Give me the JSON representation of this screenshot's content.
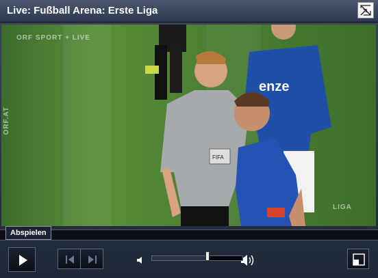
{
  "window": {
    "title": "Live: Fußball Arena: Erste Liga"
  },
  "video": {
    "watermark_top": "ORF SPORT + LIVE",
    "watermark_side": "ORF.AT",
    "watermark_corner": "LIGA",
    "jersey_text": "enze",
    "referee_badge": "FIFA"
  },
  "tooltip": {
    "label": "Abspielen"
  },
  "controls": {
    "play_icon": "play-icon",
    "prev_icon": "skip-back-icon",
    "next_icon": "skip-forward-icon",
    "volume_low_icon": "speaker-low-icon",
    "volume_high_icon": "speaker-high-icon",
    "fullscreen_icon": "fullscreen-icon",
    "volume_level": 0.62
  },
  "colors": {
    "accent": "#5b6880",
    "title_bg": "#3a4862",
    "field": "#4b7f32"
  }
}
